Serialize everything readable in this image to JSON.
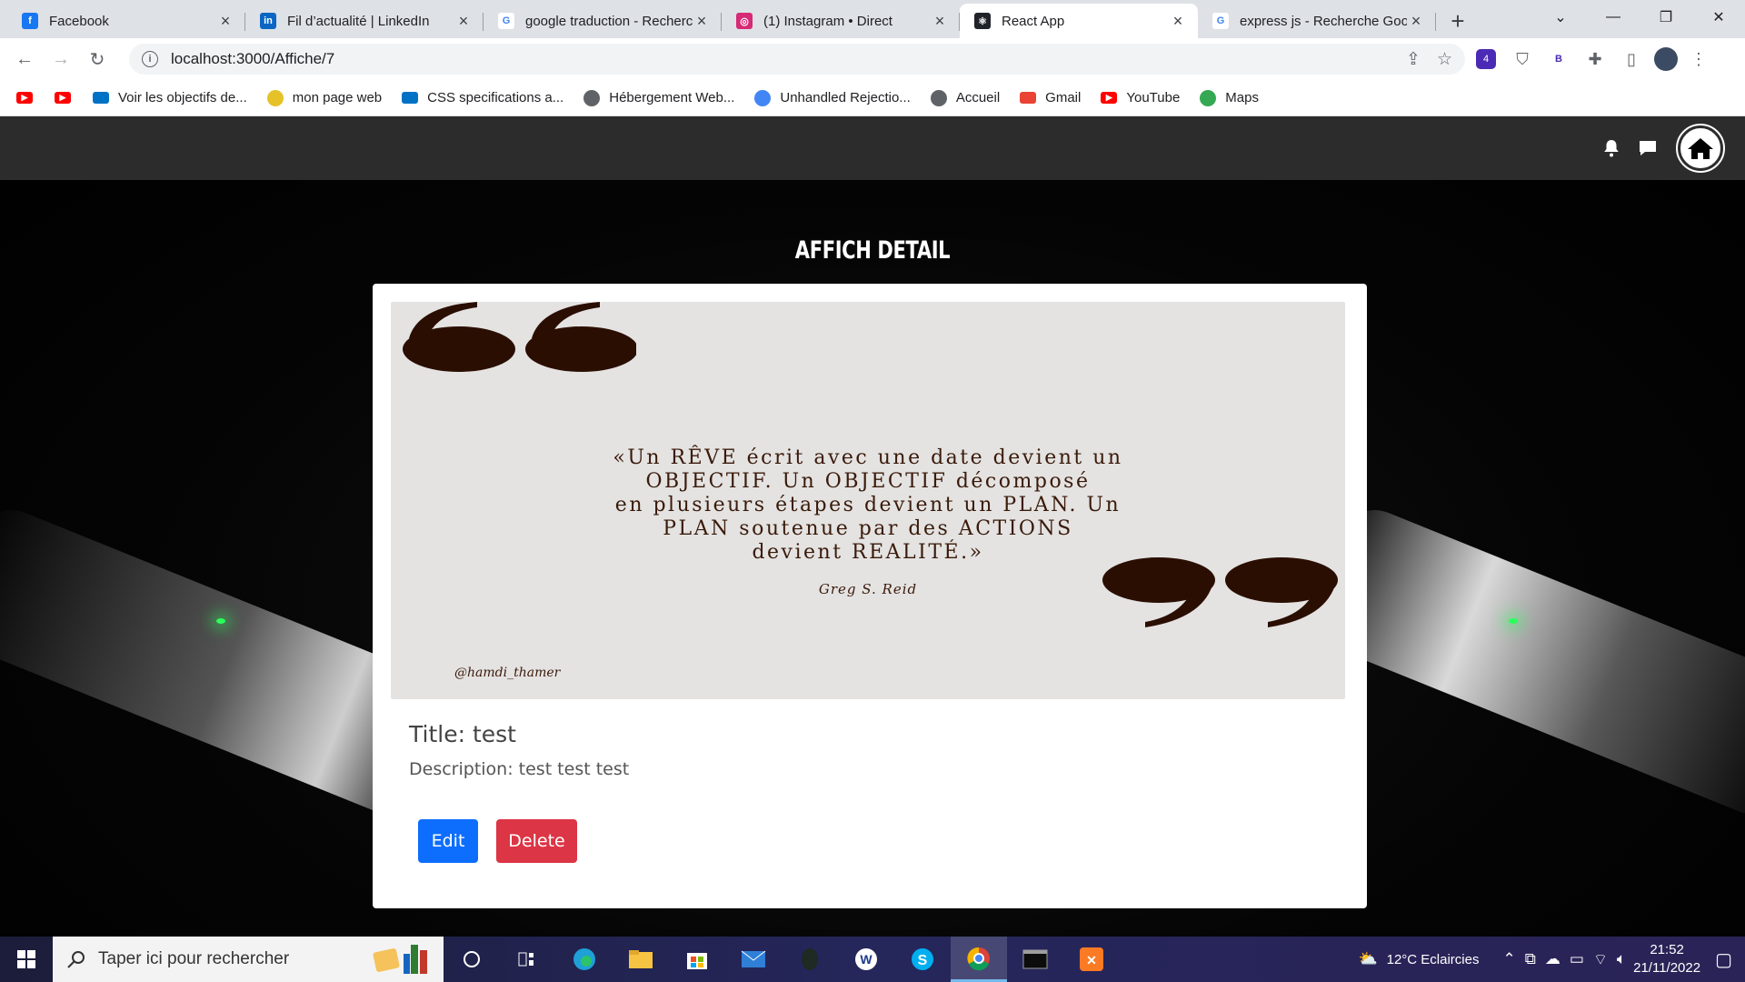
{
  "browser": {
    "tabs": [
      {
        "title": "Facebook",
        "icon": "facebook-icon",
        "color": "#1877f2",
        "glyph": "f"
      },
      {
        "title": "Fil d’actualité | LinkedIn",
        "icon": "linkedin-icon",
        "color": "#0a66c2",
        "glyph": "in"
      },
      {
        "title": "google traduction - Recherche Google",
        "icon": "google-icon",
        "color": "#ffffff",
        "glyph": "G"
      },
      {
        "title": "(1) Instagram • Direct",
        "icon": "instagram-icon",
        "color": "#d62976",
        "glyph": "◎"
      },
      {
        "title": "React App",
        "icon": "react-icon",
        "color": "#20232a",
        "glyph": "⚛",
        "active": true
      },
      {
        "title": "express js - Recherche Google",
        "icon": "google-icon",
        "color": "#ffffff",
        "glyph": "G"
      }
    ],
    "url": "localhost:3000/Affiche/7",
    "bookmarks": [
      {
        "label": "",
        "icon": "youtube-icon",
        "color": "#ff0000"
      },
      {
        "label": "",
        "icon": "youtube-icon",
        "color": "#ff0000"
      },
      {
        "label": "Voir les objectifs de...",
        "icon": "outlook-icon",
        "color": "#0072c6"
      },
      {
        "label": "mon page web",
        "icon": "smiley-icon",
        "color": "#e6c229"
      },
      {
        "label": "CSS specifications a...",
        "icon": "css-icon",
        "color": "#0072c6"
      },
      {
        "label": "Hébergement Web...",
        "icon": "globe-icon",
        "color": "#5f6368"
      },
      {
        "label": "Unhandled Rejectio...",
        "icon": "google-icon",
        "color": "#4285f4"
      },
      {
        "label": "Accueil",
        "icon": "globe-icon",
        "color": "#5f6368"
      },
      {
        "label": "Gmail",
        "icon": "gmail-icon",
        "color": "#ea4335"
      },
      {
        "label": "YouTube",
        "icon": "youtube-icon",
        "color": "#ff0000"
      },
      {
        "label": "Maps",
        "icon": "maps-icon",
        "color": "#34a853"
      }
    ],
    "extension_badge": "4",
    "extension_letter": "B"
  },
  "app": {
    "page_title": "AFFICH DETAIL",
    "quote": {
      "lines": [
        "«Un RÊVE écrit avec une date devient un",
        "OBJECTIF. Un OBJECTIF décomposé",
        "en plusieurs étapes devient un PLAN. Un",
        "PLAN soutenue par des ACTIONS",
        "devient REALITÉ.»"
      ],
      "author": "Greg S. Reid",
      "handle": "@hamdi_thamer"
    },
    "title_label": "Title: test",
    "description_label": "Description: test test test",
    "edit_label": "Edit",
    "delete_label": "Delete",
    "colors": {
      "nav": "#2c2c2c",
      "edit": "#0d6efd",
      "delete": "#dc3545",
      "quote_brown": "#2b0e02"
    }
  },
  "taskbar": {
    "search_placeholder": "Taper ici pour rechercher",
    "weather": "12°C  Eclaircies",
    "time": "21:52",
    "date": "21/11/2022"
  }
}
